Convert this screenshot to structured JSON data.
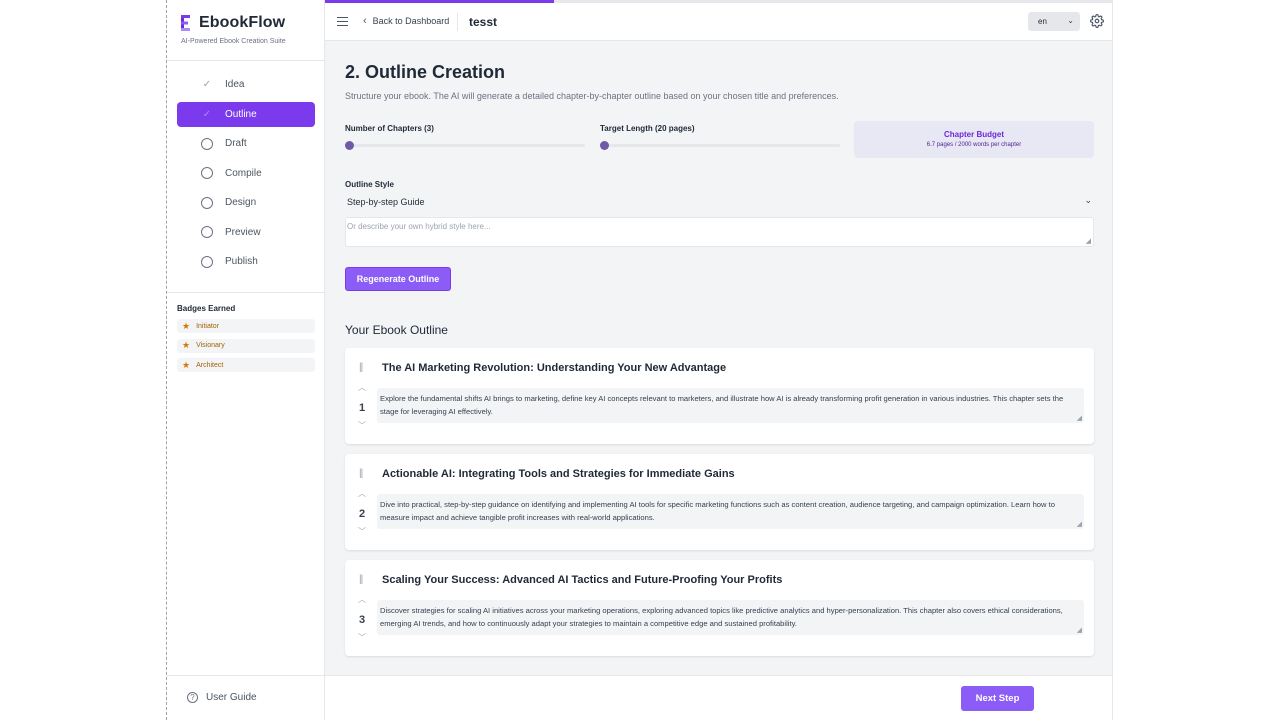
{
  "brand": {
    "title": "EbookFlow",
    "subtitle": "AI-Powered Ebook Creation Suite"
  },
  "steps": [
    {
      "label": "Idea",
      "state": "done"
    },
    {
      "label": "Outline",
      "state": "active"
    },
    {
      "label": "Draft",
      "state": "todo"
    },
    {
      "label": "Compile",
      "state": "todo"
    },
    {
      "label": "Design",
      "state": "todo"
    },
    {
      "label": "Preview",
      "state": "todo"
    },
    {
      "label": "Publish",
      "state": "todo"
    }
  ],
  "badges": {
    "title": "Badges Earned",
    "items": [
      "Initiator",
      "Visionary",
      "Architect"
    ]
  },
  "footer": {
    "guide_label": "User Guide",
    "next_label": "Next Step"
  },
  "topbar": {
    "back_label": "Back to Dashboard",
    "project_title": "tesst",
    "language": "en"
  },
  "page": {
    "heading": "2. Outline Creation",
    "description": "Structure your ebook. The AI will generate a detailed chapter-by-chapter outline based on your chosen title and preferences."
  },
  "settings": {
    "chapters_label": "Number of Chapters (3)",
    "length_label": "Target Length (20 pages)",
    "chapters_slider_value": 0,
    "length_slider_value": 0,
    "budget_title": "Chapter Budget",
    "budget_detail": "6.7 pages / 2000 words per chapter",
    "style_label": "Outline Style",
    "style_value": "Step-by-step Guide",
    "hybrid_placeholder": "Or describe your own hybrid style here...",
    "regenerate_label": "Regenerate Outline"
  },
  "outline": {
    "title": "Your Ebook Outline",
    "chapters": [
      {
        "number": "1",
        "title": "The AI Marketing Revolution: Understanding Your New Advantage",
        "description": "Explore the fundamental shifts AI brings to marketing, define key AI concepts relevant to marketers, and illustrate how AI is already transforming profit generation in various industries. This chapter sets the stage for leveraging AI effectively."
      },
      {
        "number": "2",
        "title": "Actionable AI: Integrating Tools and Strategies for Immediate Gains",
        "description": "Dive into practical, step-by-step guidance on identifying and implementing AI tools for specific marketing functions such as content creation, audience targeting, and campaign optimization. Learn how to measure impact and achieve tangible profit increases with real-world applications."
      },
      {
        "number": "3",
        "title": "Scaling Your Success: Advanced AI Tactics and Future-Proofing Your Profits",
        "description": "Discover strategies for scaling AI initiatives across your marketing operations, exploring advanced topics like predictive analytics and hyper-personalization. This chapter also covers ethical considerations, emerging AI trends, and how to continuously adapt your strategies to maintain a competitive edge and sustained profitability."
      }
    ]
  },
  "progress_fraction": 0.29,
  "colors": {
    "accent": "#7c3aed",
    "accent_light": "#8b5cf6",
    "background": "#f3f4f6"
  },
  "icons": {
    "logo": "ebookflow-logo-icon",
    "menu": "menu-icon",
    "back": "chevron-left-icon",
    "settings": "gear-icon",
    "done": "check-icon",
    "todo": "circle-icon",
    "badge": "star-icon",
    "guide": "help-circle-icon",
    "drag": "drag-handle-icon",
    "up": "chevron-up-icon",
    "down": "chevron-down-icon"
  }
}
